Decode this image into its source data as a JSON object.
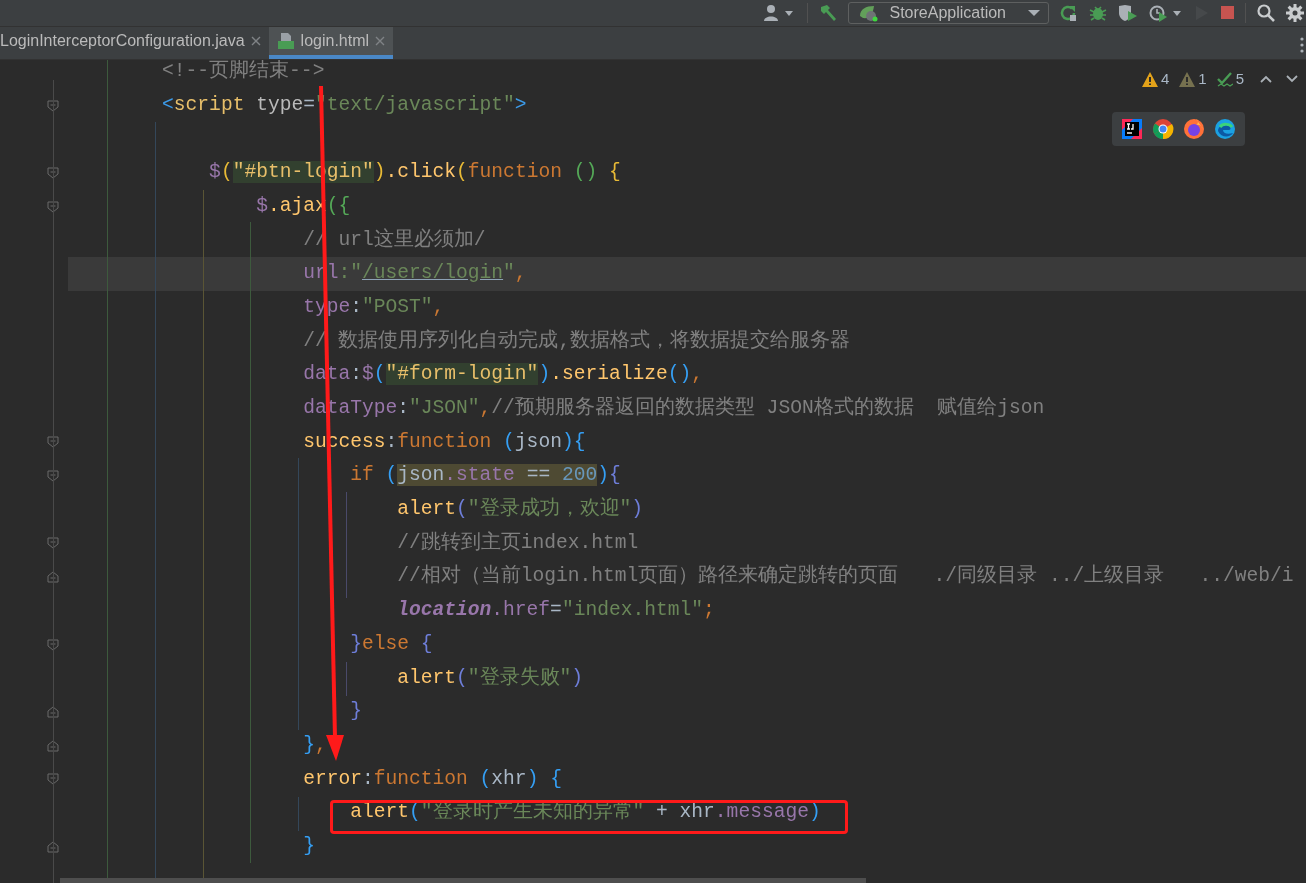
{
  "toolbar": {
    "items": [
      {
        "kind": "user",
        "disabled": false
      },
      {
        "kind": "build",
        "disabled": false
      },
      {
        "kind": "run_config",
        "label": "StoreApplication",
        "disabled": false
      },
      {
        "kind": "rerun",
        "disabled": false
      },
      {
        "kind": "debug",
        "disabled": false
      },
      {
        "kind": "coverage",
        "disabled": false
      },
      {
        "kind": "profile",
        "disabled": false
      },
      {
        "kind": "run",
        "disabled": true
      },
      {
        "kind": "stop",
        "disabled": false
      },
      {
        "kind": "search",
        "disabled": false
      },
      {
        "kind": "settings",
        "disabled": false
      }
    ]
  },
  "tabs": [
    {
      "label": "LoginInterceptorConfiguration.java",
      "kind": "java",
      "selected": false
    },
    {
      "label": "login.html",
      "kind": "html",
      "selected": true
    }
  ],
  "inspections": [
    {
      "kind": "warning",
      "count": "4"
    },
    {
      "kind": "weak_warning",
      "count": "1"
    },
    {
      "kind": "typo",
      "count": "5"
    }
  ],
  "browser_popup": {
    "items": [
      {
        "kind": "ide"
      },
      {
        "kind": "chrome"
      },
      {
        "kind": "firefox"
      },
      {
        "kind": "edge"
      }
    ]
  },
  "code_lines": [
    {
      "kind": "code",
      "current": false,
      "tokens": [
        {
          "text": "        <!--页脚结束-->",
          "kind": "comment"
        }
      ]
    },
    {
      "kind": "fold_start",
      "current": false,
      "tokens": [
        {
          "text": "        <",
          "kind": "tagbr"
        },
        {
          "text": "script",
          "kind": "tag"
        },
        {
          "text": " type",
          "kind": "attr"
        },
        {
          "text": "=",
          "kind": "plain"
        },
        {
          "text": "\"text/javascript\"",
          "kind": "string"
        },
        {
          "text": ">",
          "kind": "tagbr"
        }
      ]
    },
    {
      "kind": "code",
      "current": false
    },
    {
      "kind": "fold_start",
      "current": false,
      "tokens": [
        {
          "text": "            $",
          "kind": "prop"
        },
        {
          "text": "(",
          "kind": "br_yellow"
        },
        {
          "text": "\"#btn-login\"",
          "kind": "selector_match"
        },
        {
          "text": ")",
          "kind": "br_yellow"
        },
        {
          "text": ".click",
          "kind": "fn"
        },
        {
          "text": "(",
          "kind": "br_yellow"
        },
        {
          "text": "function",
          "kind": "keyword"
        },
        {
          "text": " ()",
          "kind": "br_green"
        },
        {
          "text": " {",
          "kind": "br_yellow"
        }
      ]
    },
    {
      "kind": "fold_start",
      "current": false,
      "tokens": [
        {
          "text": "                $",
          "kind": "prop"
        },
        {
          "text": ".ajax",
          "kind": "fn"
        },
        {
          "text": "({",
          "kind": "br_green"
        }
      ]
    },
    {
      "kind": "code",
      "current": false,
      "tokens": [
        {
          "text": "                    // url这里必须加/",
          "kind": "comment"
        }
      ]
    },
    {
      "kind": "code",
      "current": true,
      "tokens": [
        {
          "text": "                    url",
          "kind": "prop"
        },
        {
          "text": ":\"",
          "kind": "string"
        },
        {
          "text": "/users/login",
          "kind": "url"
        },
        {
          "text": "\"",
          "kind": "string"
        },
        {
          "text": ",",
          "kind": "punct"
        }
      ]
    },
    {
      "kind": "code",
      "current": false,
      "tokens": [
        {
          "text": "                    type",
          "kind": "prop"
        },
        {
          "text": ":",
          "kind": "plain"
        },
        {
          "text": "\"POST\"",
          "kind": "string"
        },
        {
          "text": ",",
          "kind": "punct"
        }
      ]
    },
    {
      "kind": "code",
      "current": false,
      "tokens": [
        {
          "text": "                    // 数据使用序列化自动完成,数据格式，将数据提交给服务器",
          "kind": "comment"
        }
      ]
    },
    {
      "kind": "code",
      "current": false,
      "tokens": [
        {
          "text": "                    data",
          "kind": "prop"
        },
        {
          "text": ":",
          "kind": "plain"
        },
        {
          "text": "$",
          "kind": "prop"
        },
        {
          "text": "(",
          "kind": "br_blue"
        },
        {
          "text": "\"#form-login\"",
          "kind": "selector_match"
        },
        {
          "text": ")",
          "kind": "br_blue"
        },
        {
          "text": ".serialize",
          "kind": "fn"
        },
        {
          "text": "()",
          "kind": "br_blue"
        },
        {
          "text": ",",
          "kind": "punct"
        }
      ]
    },
    {
      "kind": "code",
      "current": false,
      "tokens": [
        {
          "text": "                    dataType",
          "kind": "prop"
        },
        {
          "text": ":",
          "kind": "plain"
        },
        {
          "text": "\"JSON\"",
          "kind": "string"
        },
        {
          "text": ",",
          "kind": "punct"
        },
        {
          "text": "//预期服务器返回的数据类型 JSON格式的数据  赋值给json",
          "kind": "comment"
        }
      ]
    },
    {
      "kind": "fold_start",
      "current": false,
      "tokens": [
        {
          "text": "                    success",
          "kind": "fn"
        },
        {
          "text": ":",
          "kind": "plain"
        },
        {
          "text": "function",
          "kind": "keyword"
        },
        {
          "text": " (",
          "kind": "br_blue"
        },
        {
          "text": "json",
          "kind": "plain"
        },
        {
          "text": "){",
          "kind": "br_blue"
        }
      ]
    },
    {
      "kind": "fold_start",
      "current": false,
      "tokens": [
        {
          "text": "                        if",
          "kind": "keyword"
        },
        {
          "text": " (",
          "kind": "br_blue"
        },
        {
          "text": "json",
          "kind": "plain_usage"
        },
        {
          "text": ".state",
          "kind": "prop_usage"
        },
        {
          "text": " == ",
          "kind": "plain_usage"
        },
        {
          "text": "200",
          "kind": "number_usage"
        },
        {
          "text": ")",
          "kind": "br_blue"
        },
        {
          "text": "{",
          "kind": "br_purple"
        }
      ]
    },
    {
      "kind": "code",
      "current": false,
      "tokens": [
        {
          "text": "                            alert",
          "kind": "fn"
        },
        {
          "text": "(",
          "kind": "br_purple"
        },
        {
          "text": "\"登录成功，欢迎\"",
          "kind": "string"
        },
        {
          "text": ")",
          "kind": "br_purple"
        }
      ]
    },
    {
      "kind": "fold_start",
      "current": false,
      "tokens": [
        {
          "text": "                            //跳转到主页index.html",
          "kind": "comment"
        }
      ]
    },
    {
      "kind": "fold_end",
      "current": false,
      "tokens": [
        {
          "text": "                            //相对（当前login.html页面）路径来确定跳转的页面   ./同级目录 ../上级目录   ../web/i",
          "kind": "comment"
        }
      ]
    },
    {
      "kind": "code",
      "current": false,
      "tokens": [
        {
          "text": "                            location",
          "kind": "global"
        },
        {
          "text": ".href",
          "kind": "prop"
        },
        {
          "text": "=",
          "kind": "plain"
        },
        {
          "text": "\"index.html\"",
          "kind": "string"
        },
        {
          "text": ";",
          "kind": "punct"
        }
      ]
    },
    {
      "kind": "fold_start",
      "current": false,
      "tokens": [
        {
          "text": "                        }",
          "kind": "br_purple"
        },
        {
          "text": "else",
          "kind": "keyword"
        },
        {
          "text": " {",
          "kind": "br_purple"
        }
      ]
    },
    {
      "kind": "code",
      "current": false,
      "tokens": [
        {
          "text": "                            alert",
          "kind": "fn"
        },
        {
          "text": "(",
          "kind": "br_purple"
        },
        {
          "text": "\"登录失败\"",
          "kind": "string"
        },
        {
          "text": ")",
          "kind": "br_purple"
        }
      ]
    },
    {
      "kind": "fold_end",
      "current": false,
      "tokens": [
        {
          "text": "                        }",
          "kind": "br_purple"
        }
      ]
    },
    {
      "kind": "fold_end",
      "current": false,
      "tokens": [
        {
          "text": "                    }",
          "kind": "br_blue"
        },
        {
          "text": ",",
          "kind": "punct"
        }
      ]
    },
    {
      "kind": "fold_start",
      "current": false,
      "tokens": [
        {
          "text": "                    error",
          "kind": "fn"
        },
        {
          "text": ":",
          "kind": "plain"
        },
        {
          "text": "function",
          "kind": "keyword"
        },
        {
          "text": " (",
          "kind": "br_blue"
        },
        {
          "text": "xhr",
          "kind": "plain"
        },
        {
          "text": ") {",
          "kind": "br_blue"
        }
      ]
    },
    {
      "kind": "code",
      "current": false,
      "tokens": [
        {
          "text": "                        alert",
          "kind": "fn"
        },
        {
          "text": "(",
          "kind": "br_blue"
        },
        {
          "text": "\"登录时产生未知的异常\"",
          "kind": "string"
        },
        {
          "text": " + xhr",
          "kind": "plain"
        },
        {
          "text": ".message",
          "kind": "prop"
        },
        {
          "text": ")",
          "kind": "br_blue"
        }
      ]
    },
    {
      "kind": "fold_end",
      "current": false,
      "tokens": [
        {
          "text": "                    }",
          "kind": "br_blue"
        }
      ]
    }
  ],
  "annotations": {
    "arrow": true,
    "box": true
  }
}
